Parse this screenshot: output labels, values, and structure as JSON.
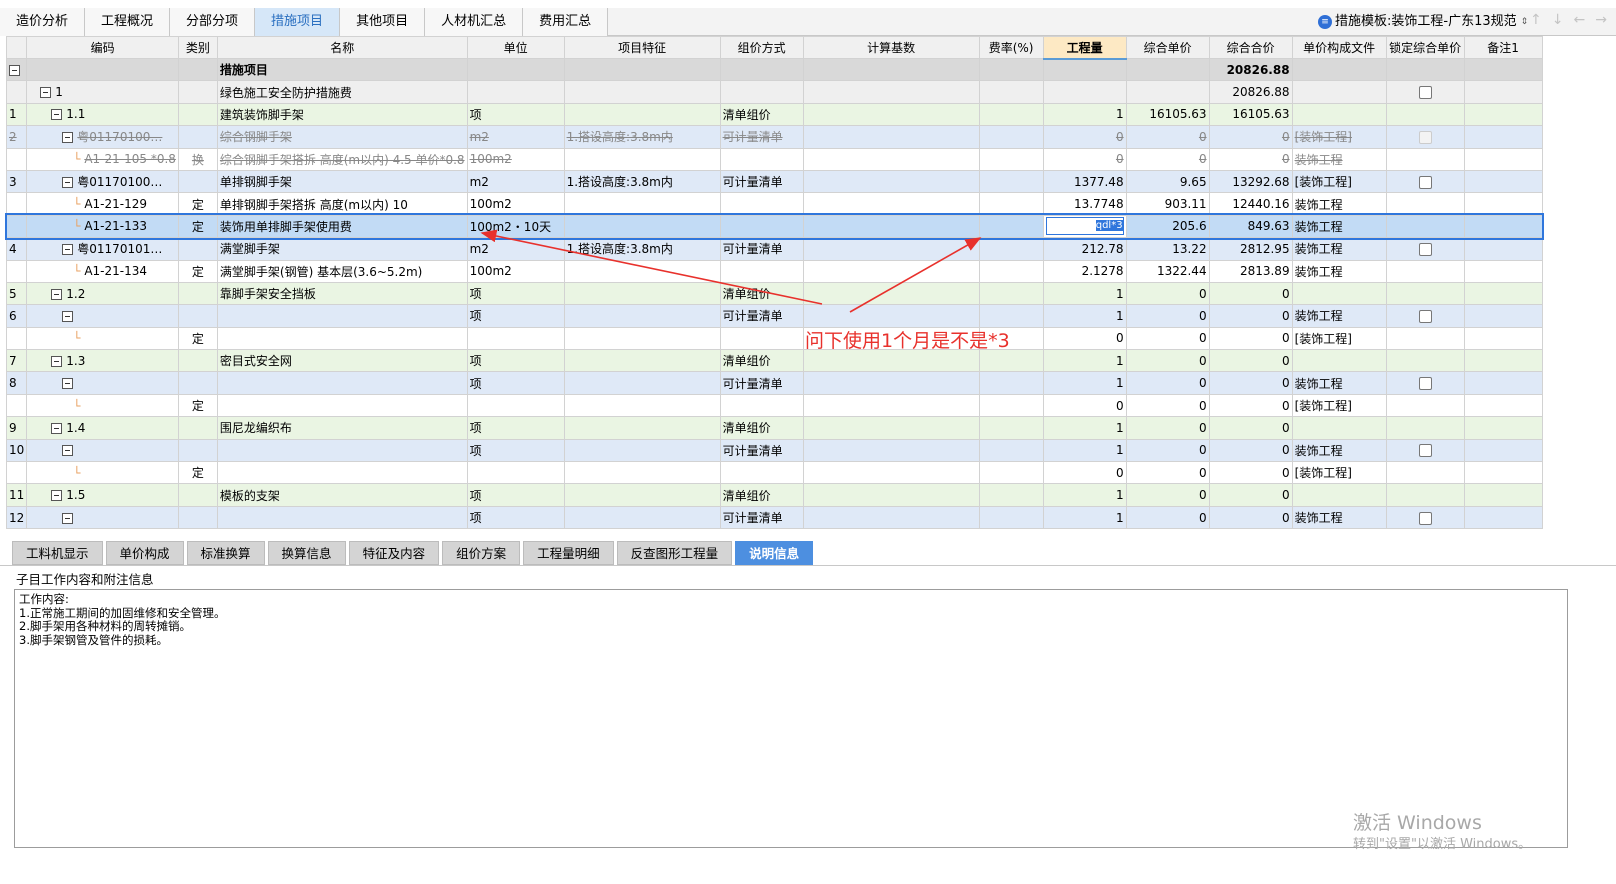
{
  "tabs": [
    "造价分析",
    "工程概况",
    "分部分项",
    "措施项目",
    "其他项目",
    "人材机汇总",
    "费用汇总"
  ],
  "active_tab": "措施项目",
  "template": {
    "label": "措施模板:装饰工程-广东13规范"
  },
  "columns": [
    "",
    "编码",
    "类别",
    "名称",
    "单位",
    "项目特征",
    "组价方式",
    "计算基数",
    "费率(%)",
    "工程量",
    "综合单价",
    "综合合价",
    "单价构成文件",
    "锁定综合单价",
    "备注1"
  ],
  "rows": [
    {
      "no": "",
      "code": "",
      "type": "",
      "name": "措施项目",
      "unit": "",
      "feature": "",
      "method": "",
      "base": "",
      "rate": "",
      "qty": "",
      "price": "",
      "total": "20826.88",
      "file": "",
      "lock": false,
      "note": ""
    },
    {
      "no": "",
      "code": "1",
      "type": "",
      "name": "绿色施工安全防护措施费",
      "unit": "",
      "feature": "",
      "method": "",
      "base": "",
      "rate": "",
      "qty": "",
      "price": "",
      "total": "20826.88",
      "file": "",
      "lock": true,
      "note": ""
    },
    {
      "no": "1",
      "code": "1.1",
      "type": "",
      "name": "建筑装饰脚手架",
      "unit": "项",
      "feature": "",
      "method": "清单组价",
      "base": "",
      "rate": "",
      "qty": "1",
      "price": "16105.63",
      "total": "16105.63",
      "file": "",
      "lock": false,
      "note": ""
    },
    {
      "no": "2",
      "code": "粤01170100…",
      "type": "",
      "name": "综合钢脚手架",
      "unit": "m2",
      "feature": "1.搭设高度:3.8m内",
      "method": "可计量清单",
      "base": "",
      "rate": "",
      "qty": "0",
      "price": "0",
      "total": "0",
      "file": "[装饰工程]",
      "lock": true,
      "note": ""
    },
    {
      "no": "",
      "code": "A1-21-105 *0.8",
      "type": "换",
      "name": "综合钢脚手架搭拆 高度(m以内) 4.5 单价*0.8",
      "unit": "100m2",
      "feature": "",
      "method": "",
      "base": "",
      "rate": "",
      "qty": "0",
      "price": "0",
      "total": "0",
      "file": "装饰工程",
      "lock": false,
      "note": ""
    },
    {
      "no": "3",
      "code": "粤01170100…",
      "type": "",
      "name": "单排钢脚手架",
      "unit": "m2",
      "feature": "1.搭设高度:3.8m内",
      "method": "可计量清单",
      "base": "",
      "rate": "",
      "qty": "1377.48",
      "price": "9.65",
      "total": "13292.68",
      "file": "[装饰工程]",
      "lock": true,
      "note": ""
    },
    {
      "no": "",
      "code": "A1-21-129",
      "type": "定",
      "name": "单排钢脚手架搭拆 高度(m以内) 10",
      "unit": "100m2",
      "feature": "",
      "method": "",
      "base": "",
      "rate": "",
      "qty": "13.7748",
      "price": "903.11",
      "total": "12440.16",
      "file": "装饰工程",
      "lock": false,
      "note": ""
    },
    {
      "no": "",
      "code": "A1-21-133",
      "type": "定",
      "name": "装饰用单排脚手架使用费",
      "unit": "100m2・10天",
      "feature": "",
      "method": "",
      "base": "",
      "rate": "",
      "qty": "qdl*3",
      "price": "205.6",
      "total": "849.63",
      "file": "装饰工程",
      "lock": false,
      "note": ""
    },
    {
      "no": "4",
      "code": "粤01170101…",
      "type": "",
      "name": "满堂脚手架",
      "unit": "m2",
      "feature": "1.搭设高度:3.8m内",
      "method": "可计量清单",
      "base": "",
      "rate": "",
      "qty": "212.78",
      "price": "13.22",
      "total": "2812.95",
      "file": "装饰工程",
      "lock": true,
      "note": ""
    },
    {
      "no": "",
      "code": "A1-21-134",
      "type": "定",
      "name": "满堂脚手架(钢管) 基本层(3.6~5.2m)",
      "unit": "100m2",
      "feature": "",
      "method": "",
      "base": "",
      "rate": "",
      "qty": "2.1278",
      "price": "1322.44",
      "total": "2813.89",
      "file": "装饰工程",
      "lock": false,
      "note": ""
    },
    {
      "no": "5",
      "code": "1.2",
      "type": "",
      "name": "靠脚手架安全挡板",
      "unit": "项",
      "feature": "",
      "method": "清单组价",
      "base": "",
      "rate": "",
      "qty": "1",
      "price": "0",
      "total": "0",
      "file": "",
      "lock": false,
      "note": ""
    },
    {
      "no": "6",
      "code": "",
      "type": "",
      "name": "",
      "unit": "项",
      "feature": "",
      "method": "可计量清单",
      "base": "",
      "rate": "",
      "qty": "1",
      "price": "0",
      "total": "0",
      "file": "装饰工程",
      "lock": true,
      "note": ""
    },
    {
      "no": "",
      "code": "",
      "type": "定",
      "name": "",
      "unit": "",
      "feature": "",
      "method": "",
      "base": "",
      "rate": "",
      "qty": "0",
      "price": "0",
      "total": "0",
      "file": "[装饰工程]",
      "lock": false,
      "note": ""
    },
    {
      "no": "7",
      "code": "1.3",
      "type": "",
      "name": "密目式安全网",
      "unit": "项",
      "feature": "",
      "method": "清单组价",
      "base": "",
      "rate": "",
      "qty": "1",
      "price": "0",
      "total": "0",
      "file": "",
      "lock": false,
      "note": ""
    },
    {
      "no": "8",
      "code": "",
      "type": "",
      "name": "",
      "unit": "项",
      "feature": "",
      "method": "可计量清单",
      "base": "",
      "rate": "",
      "qty": "1",
      "price": "0",
      "total": "0",
      "file": "装饰工程",
      "lock": true,
      "note": ""
    },
    {
      "no": "",
      "code": "",
      "type": "定",
      "name": "",
      "unit": "",
      "feature": "",
      "method": "",
      "base": "",
      "rate": "",
      "qty": "0",
      "price": "0",
      "total": "0",
      "file": "[装饰工程]",
      "lock": false,
      "note": ""
    },
    {
      "no": "9",
      "code": "1.4",
      "type": "",
      "name": "围尼龙编织布",
      "unit": "项",
      "feature": "",
      "method": "清单组价",
      "base": "",
      "rate": "",
      "qty": "1",
      "price": "0",
      "total": "0",
      "file": "",
      "lock": false,
      "note": ""
    },
    {
      "no": "10",
      "code": "",
      "type": "",
      "name": "",
      "unit": "项",
      "feature": "",
      "method": "可计量清单",
      "base": "",
      "rate": "",
      "qty": "1",
      "price": "0",
      "total": "0",
      "file": "装饰工程",
      "lock": true,
      "note": ""
    },
    {
      "no": "",
      "code": "",
      "type": "定",
      "name": "",
      "unit": "",
      "feature": "",
      "method": "",
      "base": "",
      "rate": "",
      "qty": "0",
      "price": "0",
      "total": "0",
      "file": "[装饰工程]",
      "lock": false,
      "note": ""
    },
    {
      "no": "11",
      "code": "1.5",
      "type": "",
      "name": "模板的支架",
      "unit": "项",
      "feature": "",
      "method": "清单组价",
      "base": "",
      "rate": "",
      "qty": "1",
      "price": "0",
      "total": "0",
      "file": "",
      "lock": false,
      "note": ""
    },
    {
      "no": "12",
      "code": "",
      "type": "",
      "name": "",
      "unit": "项",
      "feature": "",
      "method": "可计量清单",
      "base": "",
      "rate": "",
      "qty": "1",
      "price": "0",
      "total": "0",
      "file": "装饰工程",
      "lock": true,
      "note": ""
    }
  ],
  "bottom_tabs": [
    "工料机显示",
    "单价构成",
    "标准换算",
    "换算信息",
    "特征及内容",
    "组价方案",
    "工程量明细",
    "反查图形工程量",
    "说明信息"
  ],
  "bottom_active": "说明信息",
  "panel": {
    "title": "子目工作内容和附注信息",
    "lines": [
      "工作内容:",
      "1.正常施工期间的加固维修和安全管理。",
      "2.脚手架用各种材料的周转摊销。",
      "3.脚手架钢管及管件的损耗。"
    ]
  },
  "annotation": "问下使用1个月是不是*3",
  "watermark": {
    "line1": "激活 Windows",
    "line2": "转到\"设置\"以激活 Windows。"
  },
  "accent_color": "#e8312c"
}
